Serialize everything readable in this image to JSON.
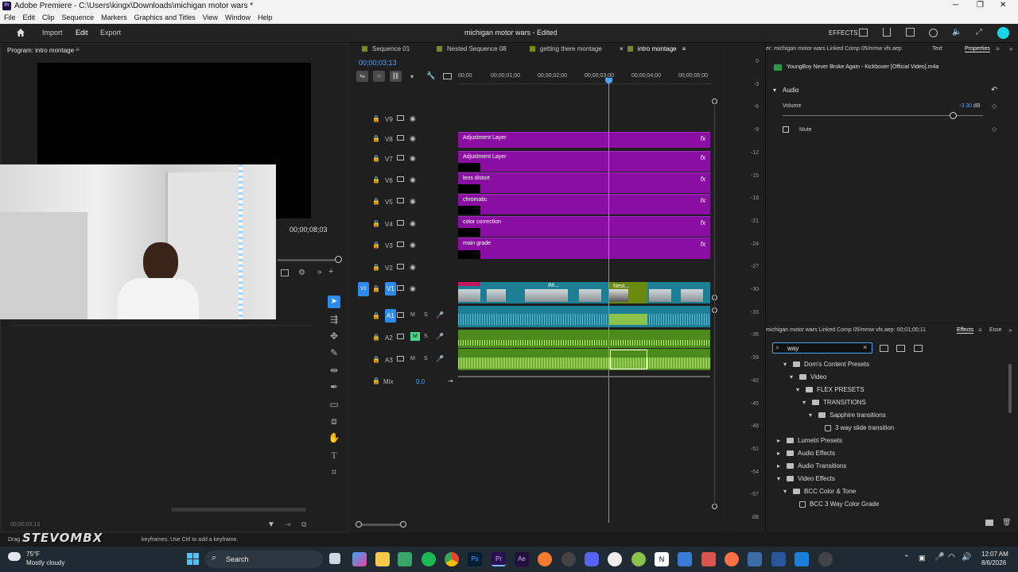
{
  "window": {
    "title": "Adobe Premiere - C:\\Users\\kingx\\Downloads\\michigan motor wars *",
    "minimize": "─",
    "maximize": "❐",
    "close": "✕"
  },
  "menu": [
    "File",
    "Edit",
    "Clip",
    "Sequence",
    "Markers",
    "Graphics and Titles",
    "View",
    "Window",
    "Help"
  ],
  "header": {
    "tabs": [
      "Import",
      "Edit",
      "Export"
    ],
    "active_tab": "Edit",
    "project_title": "michigan motor wars",
    "project_status": "- Edited",
    "effects_label": "EFFECTS"
  },
  "program": {
    "title": "Program: intro montage",
    "timecode": "00;00;08;03",
    "bottom_timecode": "00;00;03;13"
  },
  "timeline": {
    "tabs": [
      "Sequence 01",
      "Nested Sequence 08",
      "getting there montage",
      "intro montage"
    ],
    "active_tab": "intro montage",
    "playhead_time": "00;00;03;13",
    "ruler": [
      "00;00",
      "00;00;01;00",
      "00;00;02;00",
      "00;00;03;00",
      "00;00;04;00",
      "00;00;05;00"
    ],
    "video_tracks": [
      "V9",
      "V8",
      "V7",
      "V6",
      "V5",
      "V4",
      "V3",
      "V2",
      "V1"
    ],
    "audio_tracks": [
      "A1",
      "A2",
      "A3"
    ],
    "mix_label": "Mix",
    "mix_value": "0.0",
    "clips": [
      {
        "track": "V8",
        "label": "Adjustment Layer"
      },
      {
        "track": "V7",
        "label": "Adjustment Layer"
      },
      {
        "track": "V6",
        "label": "lens distort"
      },
      {
        "track": "V5",
        "label": "chromatic"
      },
      {
        "track": "V4",
        "label": "color correction"
      },
      {
        "track": "V3",
        "label": "main grade"
      }
    ],
    "v1_clip_labels": [
      "IM...",
      "Nest..."
    ],
    "fx_label": "fx"
  },
  "meter": [
    "0",
    "-3",
    "-6",
    "-9",
    "-12",
    "-15",
    "-18",
    "-21",
    "-24",
    "-27",
    "-30",
    "-33",
    "-36",
    "-39",
    "-42",
    "-45",
    "-48",
    "-51",
    "-54",
    "-57",
    "dB"
  ],
  "properties": {
    "tab_source": "er: michigan motor wars Linked Comp 05/mmw vfx.aep",
    "tab_text": "Text",
    "tab_properties": "Properties",
    "clip_name": "YoungBoy Never Broke Again - Kickboxer [Official Video].m4a",
    "section": "Audio",
    "volume_label": "Volume",
    "volume_value": "-3.30",
    "volume_unit": "dB",
    "volume_level": 0.85,
    "mute_label": "Mute"
  },
  "effects": {
    "tab_source": "michigan motor wars Linked Comp 05/mmw vfx.aep: 00;01;00;11",
    "tab_effects": "Effects",
    "tab_essential": "Esse",
    "search_value": "way",
    "tree": [
      {
        "label": "Dom's Content Presets",
        "indent": 1,
        "expanded": true,
        "kind": "folder"
      },
      {
        "label": "Video",
        "indent": 2,
        "expanded": true,
        "kind": "folder"
      },
      {
        "label": "FLEX PRESETS",
        "indent": 3,
        "expanded": true,
        "kind": "folder"
      },
      {
        "label": "TRANSITIONS",
        "indent": 4,
        "expanded": true,
        "kind": "folder"
      },
      {
        "label": "Sapphire transitions",
        "indent": 5,
        "expanded": true,
        "kind": "folder"
      },
      {
        "label": "3 way slide transition",
        "indent": 6,
        "expanded": false,
        "kind": "preset"
      },
      {
        "label": "Lumetri Presets",
        "indent": 0,
        "expanded": false,
        "kind": "folder"
      },
      {
        "label": "Audio Effects",
        "indent": 0,
        "expanded": false,
        "kind": "folder"
      },
      {
        "label": "Audio Transitions",
        "indent": 0,
        "expanded": false,
        "kind": "folder"
      },
      {
        "label": "Video Effects",
        "indent": 0,
        "expanded": true,
        "kind": "folder"
      },
      {
        "label": "BCC Color & Tone",
        "indent": 1,
        "expanded": true,
        "kind": "folder"
      },
      {
        "label": "BCC 3 Way Color Grade",
        "indent": 2,
        "expanded": false,
        "kind": "preset"
      }
    ]
  },
  "status": {
    "hint": "keyframes. Use Ctrl to add a keyframe.",
    "hint_prefix": "Drag"
  },
  "taskbar": {
    "weather_temp": "75°F",
    "weather_desc": "Mostly cloudy",
    "search_label": "Search",
    "time": "12:07 AM",
    "date": "8/6/2026"
  },
  "colors": {
    "accent_blue": "#2d8ceb",
    "adjustment_purple": "#8a0ea2",
    "audio_green": "#6eb32a",
    "video_teal": "#1d7f95"
  }
}
